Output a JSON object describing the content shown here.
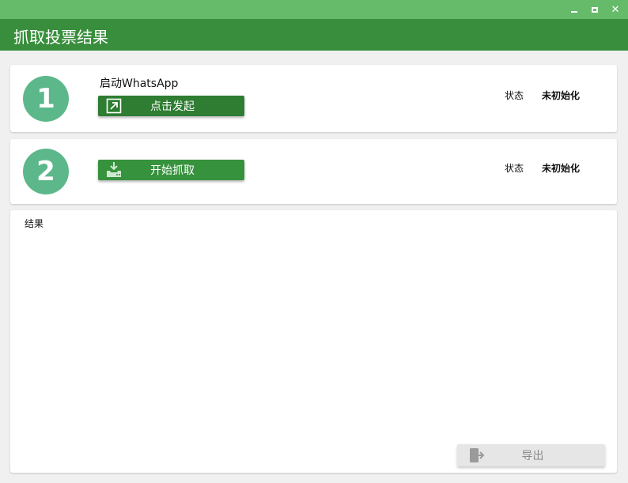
{
  "window": {
    "title": "抓取投票结果",
    "controls": [
      "minimize",
      "maximize",
      "close"
    ],
    "close_glyph": "✕"
  },
  "colors": {
    "titlebar": "#66bb6a",
    "header": "#388e3c",
    "step_circle": "#5cb88a",
    "primary_button": "#2e7d32",
    "export_button": "#e6e6e6"
  },
  "steps": [
    {
      "number": "1",
      "label": "启动WhatsApp",
      "button_label": "点击发起",
      "button_icon": "external-link-icon",
      "status_key": "状态",
      "status_value": "未初始化"
    },
    {
      "number": "2",
      "label": "",
      "button_label": "开始抓取",
      "button_icon": "download-tray-icon",
      "status_key": "状态",
      "status_value": "未初始化"
    }
  ],
  "result": {
    "label": "结果",
    "export_label": "导出",
    "export_icon": "export-icon"
  }
}
